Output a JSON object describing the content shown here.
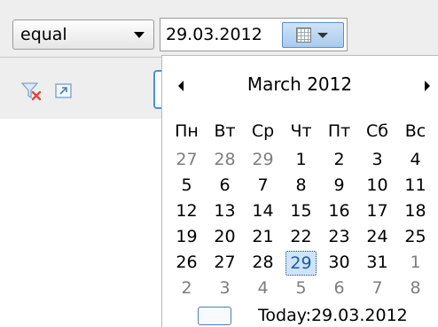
{
  "filter": {
    "operator": "equal",
    "date_value": "29.03.2012"
  },
  "calendar": {
    "month_title": "March 2012",
    "weekdays": [
      "Пн",
      "Вт",
      "Ср",
      "Чт",
      "Пт",
      "Сб",
      "Вс"
    ],
    "weeks": [
      [
        {
          "d": "27",
          "o": true
        },
        {
          "d": "28",
          "o": true
        },
        {
          "d": "29",
          "o": true
        },
        {
          "d": "1"
        },
        {
          "d": "2"
        },
        {
          "d": "3"
        },
        {
          "d": "4"
        }
      ],
      [
        {
          "d": "5"
        },
        {
          "d": "6"
        },
        {
          "d": "7"
        },
        {
          "d": "8"
        },
        {
          "d": "9"
        },
        {
          "d": "10"
        },
        {
          "d": "11"
        }
      ],
      [
        {
          "d": "12"
        },
        {
          "d": "13"
        },
        {
          "d": "14"
        },
        {
          "d": "15"
        },
        {
          "d": "16"
        },
        {
          "d": "17"
        },
        {
          "d": "18"
        }
      ],
      [
        {
          "d": "19"
        },
        {
          "d": "20"
        },
        {
          "d": "21"
        },
        {
          "d": "22"
        },
        {
          "d": "23"
        },
        {
          "d": "24"
        },
        {
          "d": "25"
        }
      ],
      [
        {
          "d": "26"
        },
        {
          "d": "27"
        },
        {
          "d": "28"
        },
        {
          "d": "29",
          "s": true
        },
        {
          "d": "30"
        },
        {
          "d": "31"
        },
        {
          "d": "1",
          "o": true
        }
      ],
      [
        {
          "d": "2",
          "o": true
        },
        {
          "d": "3",
          "o": true
        },
        {
          "d": "4",
          "o": true
        },
        {
          "d": "5",
          "o": true
        },
        {
          "d": "6",
          "o": true
        },
        {
          "d": "7",
          "o": true
        },
        {
          "d": "8",
          "o": true
        }
      ]
    ],
    "today_label": "Today:",
    "today_date": "29.03.2012"
  },
  "icons": {
    "clear_filter": "clear-filter-icon",
    "popout": "popout-icon",
    "calendar": "calendar-icon",
    "prev": "prev-month-icon",
    "next": "next-month-icon"
  },
  "colors": {
    "accent": "#4a90d9",
    "selected_fill": "#cde4fb",
    "other_month": "#7d7d7d"
  }
}
